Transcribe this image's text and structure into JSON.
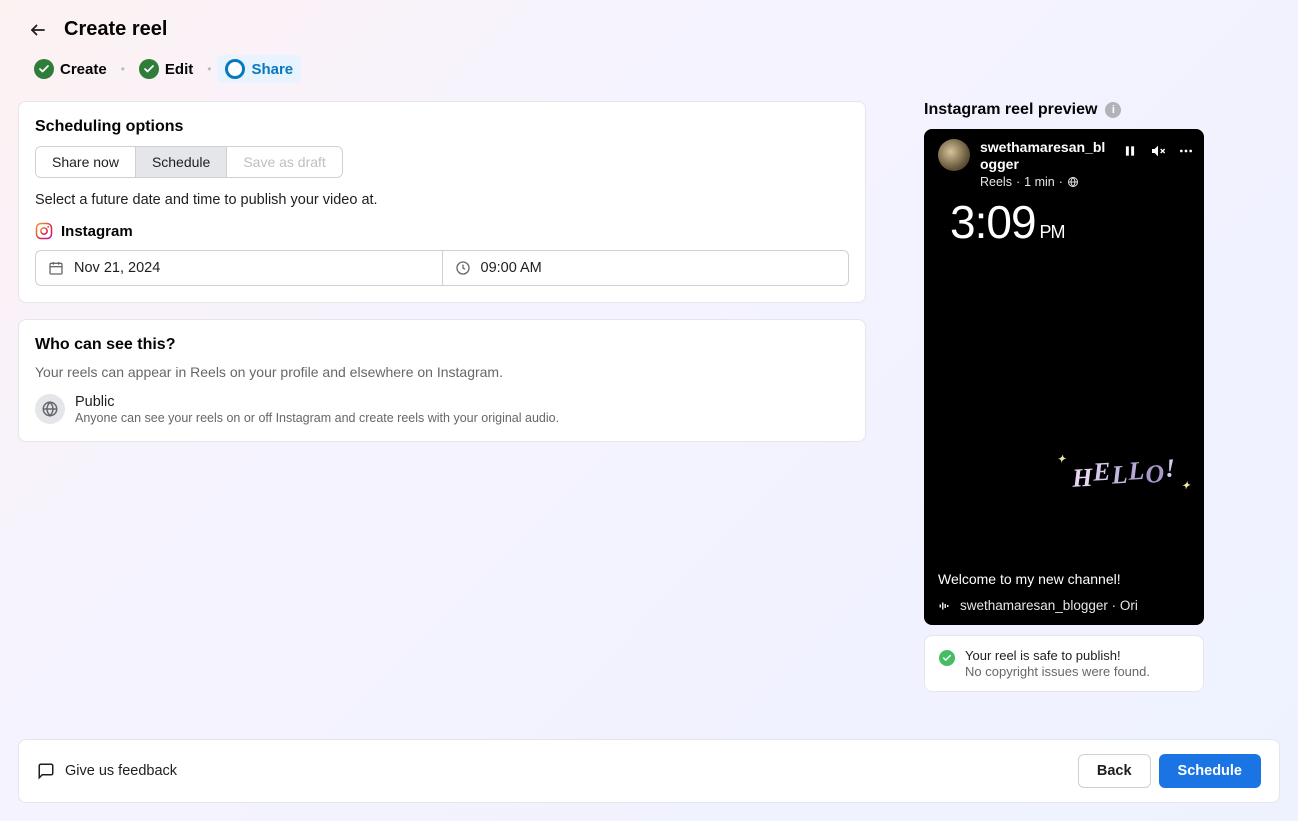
{
  "header": {
    "title": "Create reel"
  },
  "steps": {
    "create": "Create",
    "edit": "Edit",
    "share": "Share"
  },
  "scheduling": {
    "title": "Scheduling options",
    "share_now": "Share now",
    "schedule": "Schedule",
    "save_draft": "Save as draft",
    "help": "Select a future date and time to publish your video at.",
    "platform": "Instagram",
    "date": "Nov 21, 2024",
    "time": "09:00 AM"
  },
  "visibility": {
    "title": "Who can see this?",
    "subtitle": "Your reels can appear in Reels on your profile and elsewhere on Instagram.",
    "option_name": "Public",
    "option_desc": "Anyone can see your reels on or off Instagram and create reels with your original audio."
  },
  "preview": {
    "title": "Instagram reel preview",
    "username": "swethamaresan_blogger",
    "meta_type": "Reels",
    "meta_duration": "1 min",
    "clock_time": "3:09",
    "clock_ampm": "PM",
    "caption": "Welcome to my new channel!",
    "audio": "swethamaresan_blogger · Ori"
  },
  "safety": {
    "title": "Your reel is safe to publish!",
    "subtitle": "No copyright issues were found."
  },
  "footer": {
    "feedback": "Give us feedback",
    "back": "Back",
    "schedule": "Schedule"
  }
}
